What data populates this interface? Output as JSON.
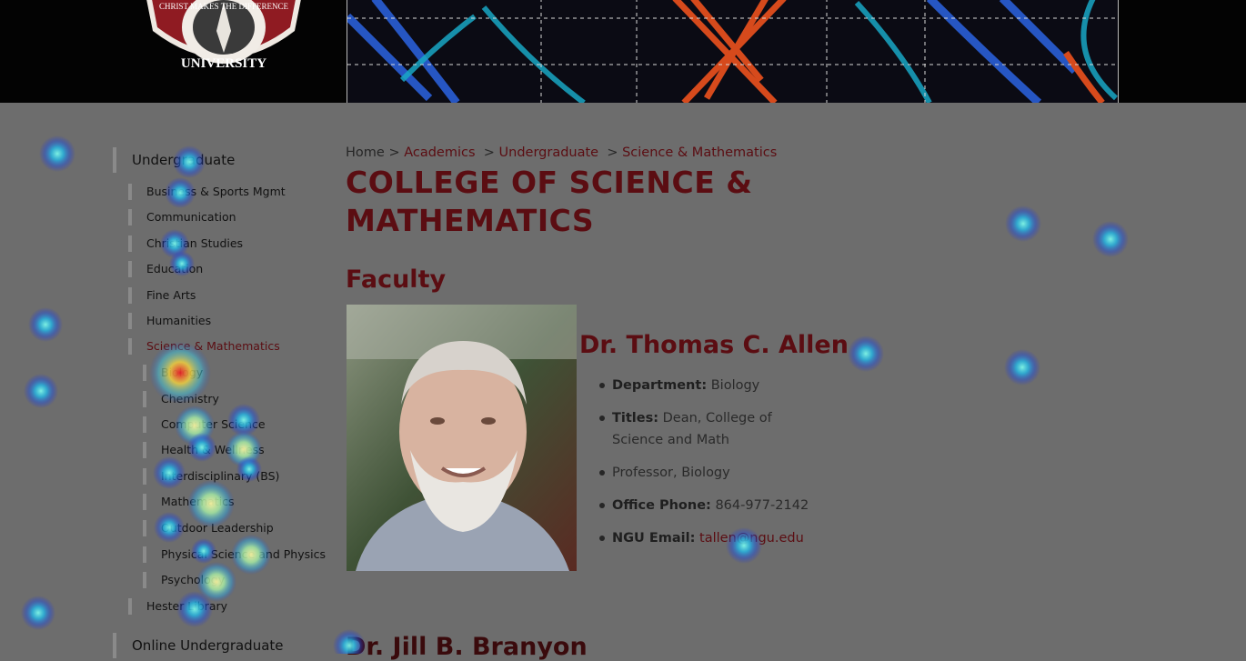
{
  "header": {
    "seal_line1": "CHRIST MAKES THE DIFFERENCE",
    "seal_line2": "UNIVERSITY"
  },
  "sidebar": {
    "section": "Undergraduate",
    "items": [
      {
        "label": "Business & Sports Mgmt"
      },
      {
        "label": "Communication"
      },
      {
        "label": "Christian Studies"
      },
      {
        "label": "Education"
      },
      {
        "label": "Fine Arts"
      },
      {
        "label": "Humanities"
      },
      {
        "label": "Science & Mathematics"
      }
    ],
    "subitems": [
      {
        "label": "Biology"
      },
      {
        "label": "Chemistry"
      },
      {
        "label": "Computer Science"
      },
      {
        "label": "Health & Wellness"
      },
      {
        "label": "Interdisciplinary (BS)"
      },
      {
        "label": "Mathematics"
      },
      {
        "label": "Outdoor Leadership"
      },
      {
        "label": "Physical Science and Physics"
      },
      {
        "label": "Psychology"
      }
    ],
    "library": "Hester Library",
    "next_section": "Online Undergraduate"
  },
  "breadcrumb": {
    "home": "Home",
    "sep": ">",
    "academics": "Academics",
    "undergraduate": "Undergraduate",
    "current": "Science & Mathematics"
  },
  "page": {
    "title_line1": "COLLEGE OF SCIENCE &",
    "title_line2": "MATHEMATICS",
    "section": "Faculty"
  },
  "faculty": {
    "name": "Dr. Thomas C. Allen",
    "dept_label": "Department:",
    "dept_value": "Biology",
    "titles_label": "Titles:",
    "titles_value": "Dean, College of Science and Math",
    "role": "Professor, Biology",
    "phone_label": "Office Phone:",
    "phone_value": "864-977-2142",
    "email_label": "NGU Email:",
    "email_value": "tallen@ngu.edu"
  },
  "next_faculty": {
    "name": "Dr. Jill B. Branyon"
  },
  "colors": {
    "brand": "#5b0d12",
    "overlay": "#6d6d6d",
    "header_bg": "#030303"
  }
}
